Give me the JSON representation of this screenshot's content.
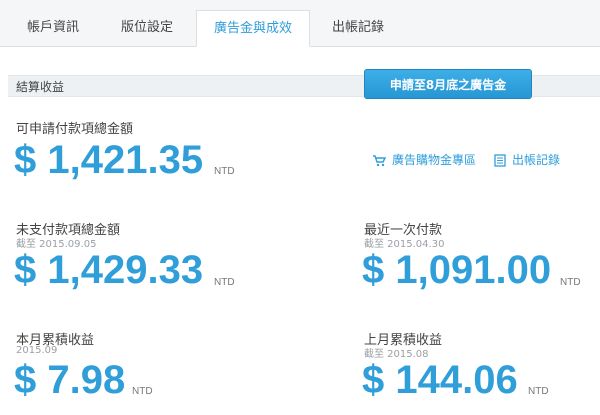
{
  "tabs": [
    {
      "label": "帳戶資訊"
    },
    {
      "label": "版位設定"
    },
    {
      "label": "廣告金與成效"
    },
    {
      "label": "出帳記錄"
    }
  ],
  "section": {
    "title": "結算收益"
  },
  "payable": {
    "label": "可申請付款項總金額",
    "amount": "$ 1,421.35",
    "unit": "NTD"
  },
  "actions": {
    "apply_button": "申請至8月底之廣告金",
    "shop_link": "廣告購物金專區",
    "records_link": "出帳記錄"
  },
  "unpaid": {
    "label": "未支付款項總金額",
    "sub": "截至 2015.09.05",
    "amount": "$ 1,429.33",
    "unit": "NTD"
  },
  "last_payment": {
    "label": "最近一次付款",
    "sub": "截至 2015.04.30",
    "amount": "$ 1,091.00",
    "unit": "NTD"
  },
  "this_month": {
    "label": "本月累積收益",
    "sub": "2015.09",
    "amount": "$ 7.98",
    "unit": "NTD"
  },
  "last_month": {
    "label": "上月累積收益",
    "sub": "截至 2015.08",
    "amount": "$ 144.06",
    "unit": "NTD"
  },
  "colors": {
    "accent": "#2f9ed9",
    "tab_bg": "#f4f6f8",
    "section_bg": "#eef1f4"
  }
}
